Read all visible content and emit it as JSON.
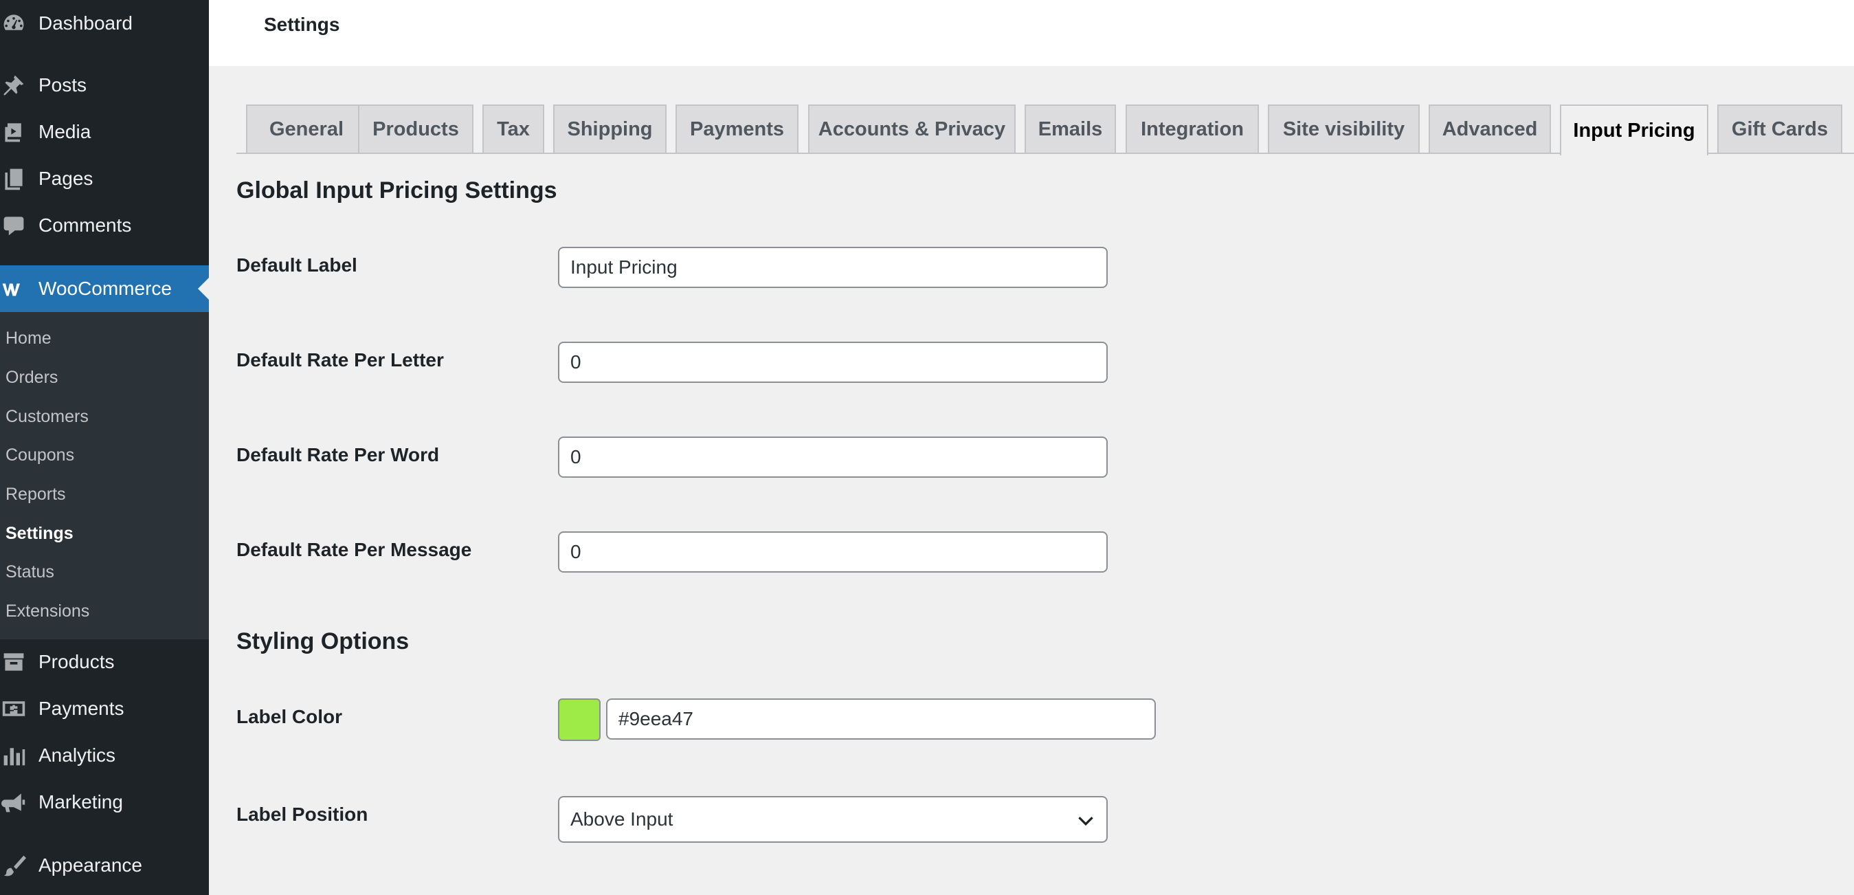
{
  "sidebar": {
    "menu": [
      {
        "label": "Dashboard",
        "icon": "dashboard-icon"
      },
      {
        "label": "Posts",
        "icon": "pin-icon"
      },
      {
        "label": "Media",
        "icon": "media-icon"
      },
      {
        "label": "Pages",
        "icon": "pages-icon"
      },
      {
        "label": "Comments",
        "icon": "comment-icon"
      },
      {
        "label": "WooCommerce",
        "icon": "woo-icon"
      },
      {
        "label": "Products",
        "icon": "archive-icon"
      },
      {
        "label": "Payments",
        "icon": "payments-icon"
      },
      {
        "label": "Analytics",
        "icon": "chart-bars-icon"
      },
      {
        "label": "Marketing",
        "icon": "megaphone-icon"
      },
      {
        "label": "Appearance",
        "icon": "brush-icon"
      }
    ],
    "submenu": [
      "Home",
      "Orders",
      "Customers",
      "Coupons",
      "Reports",
      "Settings",
      "Status",
      "Extensions"
    ],
    "active_menu": "WooCommerce",
    "current_submenu": "Settings",
    "colors": {
      "background": "#1d2327",
      "active": "#2271b1",
      "submenu_bg": "#2c3338"
    }
  },
  "header": {
    "title": "Settings"
  },
  "tabs": [
    "General",
    "Products",
    "Tax",
    "Shipping",
    "Payments",
    "Accounts & Privacy",
    "Emails",
    "Integration",
    "Site visibility",
    "Advanced",
    "Input Pricing",
    "Gift Cards"
  ],
  "active_tab": "Input Pricing",
  "global_section": {
    "title": "Global Input Pricing Settings",
    "fields": [
      {
        "label": "Default Label",
        "value": "Input Pricing"
      },
      {
        "label": "Default Rate Per Letter",
        "value": "0"
      },
      {
        "label": "Default Rate Per Word",
        "value": "0"
      },
      {
        "label": "Default Rate Per Message",
        "value": "0"
      }
    ]
  },
  "styling_section": {
    "title": "Styling Options",
    "label_color": {
      "label": "Label Color",
      "value": "#9eea47",
      "swatch": "#9eea47"
    },
    "label_position": {
      "label": "Label Position",
      "selected": "Above Input"
    }
  }
}
